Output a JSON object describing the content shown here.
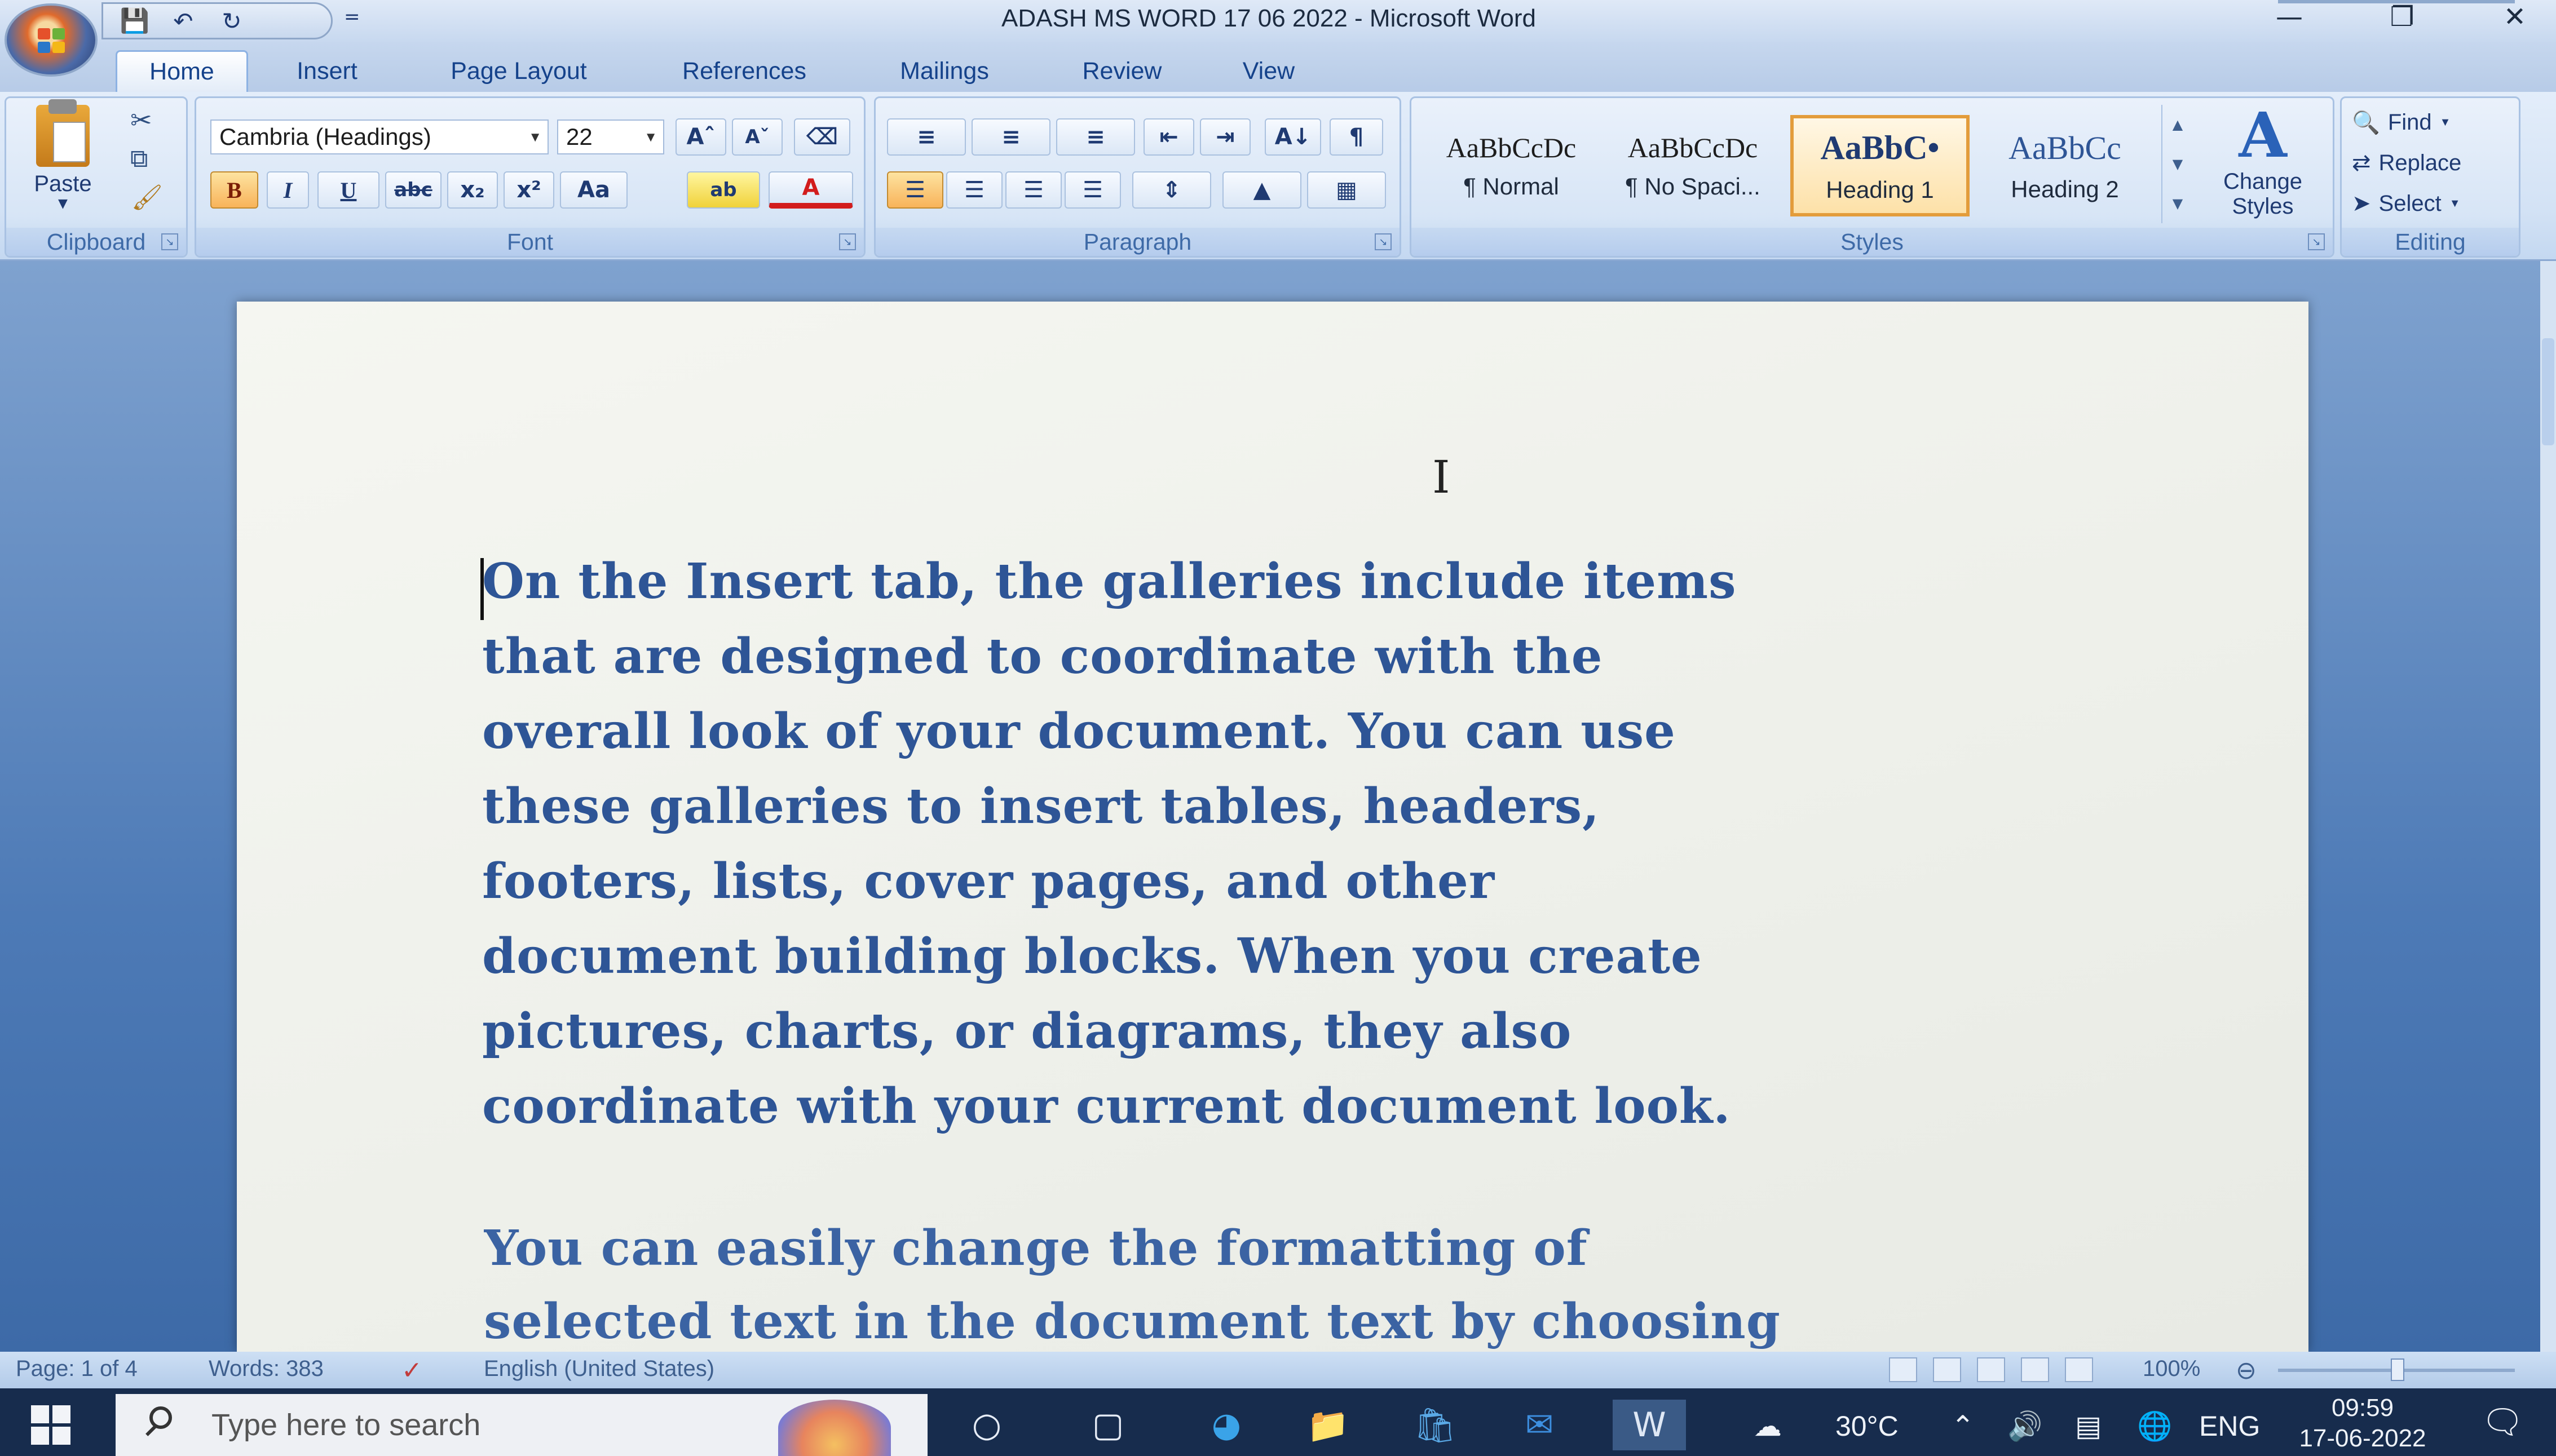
{
  "app": {
    "window_title": "ADASH MS WORD 17 06 2022  -  Microsoft Word"
  },
  "qat": {
    "more": "="
  },
  "tabs": [
    {
      "label": "Home"
    },
    {
      "label": "Insert"
    },
    {
      "label": "Page Layout"
    },
    {
      "label": "References"
    },
    {
      "label": "Mailings"
    },
    {
      "label": "Review"
    },
    {
      "label": "View"
    }
  ],
  "ribbon": {
    "clipboard": {
      "label": "Clipboard",
      "paste": "Paste"
    },
    "font": {
      "label": "Font",
      "font_name": "Cambria (Headings)",
      "font_size": "22",
      "grow": "Aˆ",
      "shrink": "Aˇ",
      "bold": "B",
      "italic": "I",
      "underline": "U",
      "strike": "abc",
      "sub": "x₂",
      "sup": "x²",
      "case": "Aa",
      "highlight": "ab",
      "color": "A"
    },
    "paragraph": {
      "label": "Paragraph",
      "pilcrow": "¶",
      "sort": "A↓"
    },
    "styles": {
      "label": "Styles",
      "items": [
        {
          "preview": "AaBbCcDc",
          "name": "¶ Normal"
        },
        {
          "preview": "AaBbCcDc",
          "name": "¶ No Spaci..."
        },
        {
          "preview": "AaBbC•",
          "name": "Heading 1"
        },
        {
          "preview": "AaBbCc",
          "name": "Heading 2"
        }
      ],
      "change_styles": "Change Styles"
    },
    "editing": {
      "label": "Editing",
      "find": "Find",
      "replace": "Replace",
      "select": "Select"
    }
  },
  "document": {
    "paragraph1": "On the Insert tab, the galleries include items that are designed to coordinate with the overall look of your document. You can use these galleries to insert tables, headers, footers, lists, cover pages, and other document building blocks. When you create pictures, charts, or diagrams, they also coordinate with your current document look.",
    "paragraph1_lines": [
      "On the Insert tab, the galleries include items",
      "that are designed to coordinate with the",
      "overall look of your document. You can use",
      "these galleries to insert tables, headers,",
      "footers, lists, cover pages, and other",
      "document building blocks. When you create",
      "pictures, charts, or diagrams, they also",
      "coordinate with your current document look."
    ],
    "paragraph2_lines": [
      "You can easily change the formatting of",
      "selected text in the document text by choosing"
    ]
  },
  "statusbar": {
    "page": "Page: 1 of 4",
    "words": "Words: 383",
    "language": "English (United States)",
    "zoom": "100%"
  },
  "taskbar": {
    "search_placeholder": "Type here to search",
    "temperature": "30°C",
    "language": "ENG",
    "time": "09:59",
    "date": "17-06-2022"
  },
  "colors": {
    "body_text": "#2e5596",
    "ribbon_bg": "#d3e2f5",
    "taskbar": "#172c4d",
    "selected_style_border": "#e39c3b"
  }
}
